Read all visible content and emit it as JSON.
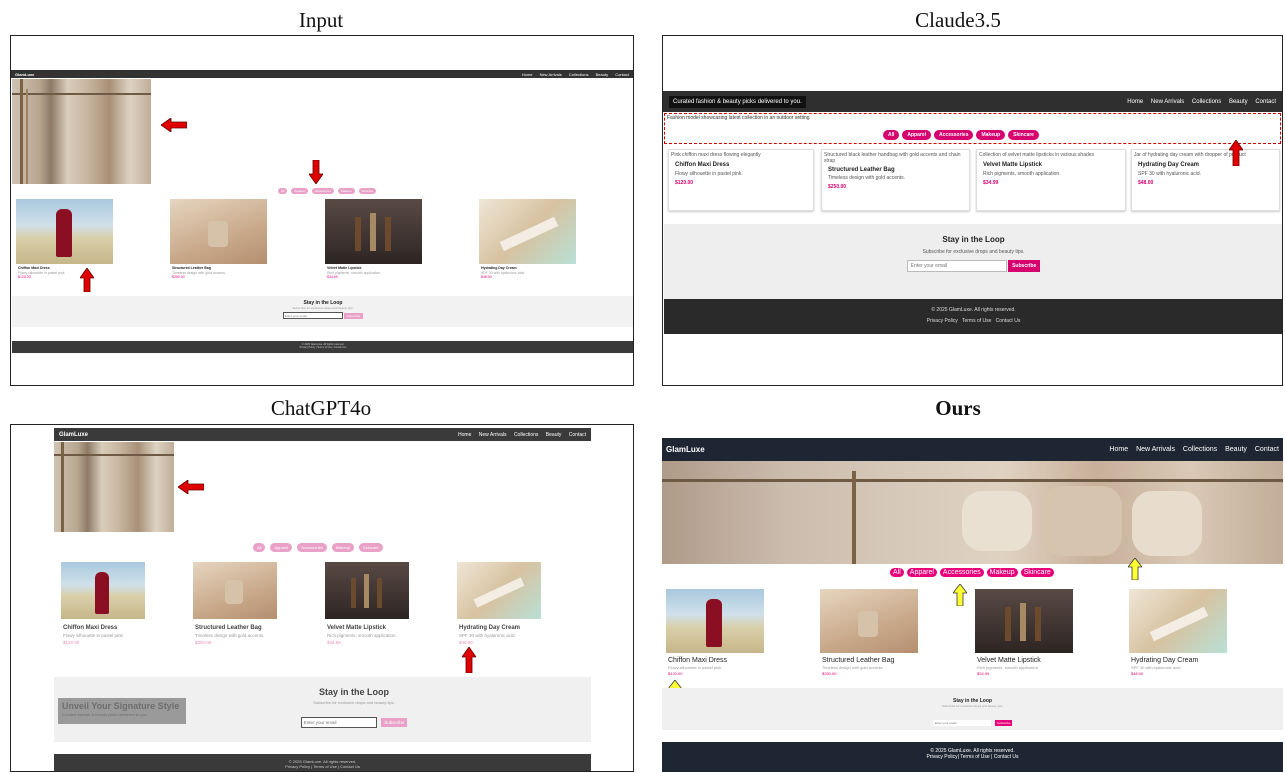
{
  "panels": {
    "input": {
      "title": "Input"
    },
    "claude": {
      "title": "Claude3.5"
    },
    "gpt": {
      "title": "ChatGPT4o"
    },
    "ours": {
      "title": "Ours"
    }
  },
  "site": {
    "brand": "GlamLuxe",
    "nav": [
      "Home",
      "New Arrivals",
      "Collections",
      "Beauty",
      "Contact"
    ],
    "tagline": "Curated fashion & beauty picks delivered to you.",
    "hero_alt": "Fashion model showcasing latest collection in an outdoor setting",
    "filters": [
      "All",
      "Apparel",
      "Accessories",
      "Makeup",
      "Skincare"
    ],
    "products": [
      {
        "name": "Chiffon Maxi Dress",
        "desc": "Flowy silhouette in pastel pink.",
        "price": "$120.00",
        "alt": "Pink chiffon maxi dress flowing elegantly"
      },
      {
        "name": "Structured Leather Bag",
        "desc": "Timeless design with gold accents.",
        "price": "$250.00",
        "alt": "Structured black leather handbag with gold accents and chain strap"
      },
      {
        "name": "Velvet Matte Lipstick",
        "desc": "Rich pigments, smooth application.",
        "price": "$34.99",
        "alt": "Collection of velvet matte lipsticks in various shades"
      },
      {
        "name": "Hydrating Day Cream",
        "desc": "SPF 30 with hyaluronic acid.",
        "price": "$48.00",
        "alt": "Jar of hydrating day cream with dropper of product"
      }
    ],
    "newsletter": {
      "title": "Stay in the Loop",
      "subtitle": "Subscribe for exclusive drops and beauty tips.",
      "placeholder": "Enter your email",
      "button": "Subscribe"
    },
    "footer": {
      "copyright": "© 2025 GlamLuxe. All rights reserved.",
      "links": [
        "Privacy Policy",
        "Terms of Use",
        "Contact Us"
      ]
    },
    "gpt_banner": {
      "title": "Unveil Your Signature Style",
      "subtitle": "Curated fashion & beauty picks delivered to you."
    }
  },
  "colors": {
    "nav_dark": "#333333",
    "nav_navy": "#1f2633",
    "pink": "#e8007a",
    "pink_soft": "#e9a1c8",
    "arrow_red": "#e00000",
    "arrow_yellow": "#ffff33"
  }
}
